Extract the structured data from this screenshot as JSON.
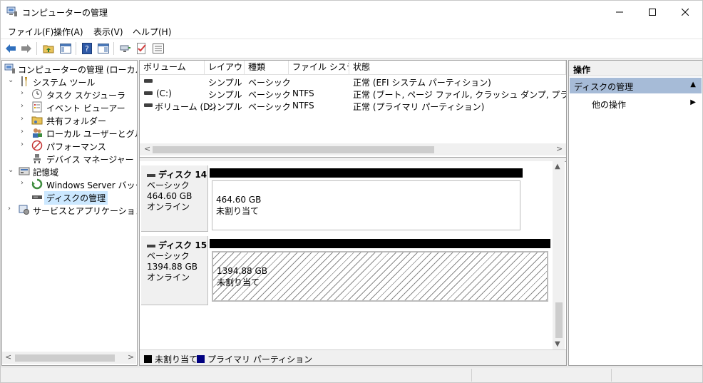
{
  "window": {
    "title": "コンピューターの管理",
    "minimize_glyph": "—",
    "maximize_glyph": "☐",
    "close_glyph": "✕"
  },
  "menu": [
    "ファイル(F)",
    "操作(A)",
    "表示(V)",
    "ヘルプ(H)"
  ],
  "toolbar": [
    "back-icon",
    "forward-icon",
    "up-folder-icon",
    "show-hide-tree-icon",
    "help-icon",
    "properties-icon",
    "connect-icon",
    "check-icon",
    "list-icon"
  ],
  "tree": {
    "items": [
      {
        "label": "コンピューターの管理 (ローカル)",
        "icon": "computer-management-icon",
        "expander": ""
      },
      {
        "label": "システム ツール",
        "icon": "system-tools-icon",
        "expander": "⌄"
      },
      {
        "label": "タスク スケジューラ",
        "icon": "task-scheduler-icon",
        "expander": "›"
      },
      {
        "label": "イベント ビューアー",
        "icon": "event-viewer-icon",
        "expander": "›"
      },
      {
        "label": "共有フォルダー",
        "icon": "shared-folders-icon",
        "expander": "›"
      },
      {
        "label": "ローカル ユーザーとグループ",
        "icon": "users-groups-icon",
        "expander": "›"
      },
      {
        "label": "パフォーマンス",
        "icon": "performance-icon",
        "expander": "›"
      },
      {
        "label": "デバイス マネージャー",
        "icon": "device-manager-icon",
        "expander": ""
      },
      {
        "label": "記憶域",
        "icon": "storage-icon",
        "expander": "⌄"
      },
      {
        "label": "Windows Server バックア",
        "icon": "backup-icon",
        "expander": "›"
      },
      {
        "label": "ディスクの管理",
        "icon": "disk-management-icon",
        "expander": ""
      },
      {
        "label": "サービスとアプリケーション",
        "icon": "services-icon",
        "expander": "›"
      }
    ]
  },
  "volumes": {
    "columns": [
      "ボリューム",
      "レイアウト",
      "種類",
      "ファイル システム",
      "状態"
    ],
    "rows": [
      {
        "volume": "",
        "layout": "シンプル",
        "type": "ベーシック",
        "fs": "",
        "status": "正常 (EFI システム パーティション)"
      },
      {
        "volume": "(C:)",
        "layout": "シンプル",
        "type": "ベーシック",
        "fs": "NTFS",
        "status": "正常 (ブート, ページ ファイル, クラッシュ ダンプ, プライマリ パーティション)"
      },
      {
        "volume": "ボリューム (D:)",
        "layout": "シンプル",
        "type": "ベーシック",
        "fs": "NTFS",
        "status": "正常 (プライマリ パーティション)"
      }
    ]
  },
  "disks": [
    {
      "name": "ディスク 14",
      "kind": "ベーシック",
      "size": "464.60 GB",
      "state": "オンライン",
      "partition_size": "464.60 GB",
      "partition_status": "未割り当て"
    },
    {
      "name": "ディスク 15",
      "kind": "ベーシック",
      "size": "1394.88 GB",
      "state": "オンライン",
      "partition_size": "1394.88 GB",
      "partition_status": "未割り当て"
    }
  ],
  "legend": [
    {
      "label": "未割り当て",
      "color": "#000000"
    },
    {
      "label": "プライマリ パーティション",
      "color": "#000080"
    }
  ],
  "actions": {
    "title": "操作",
    "section": "ディスクの管理",
    "item": "他の操作"
  },
  "colors": {
    "section_bg": "#a6bbd7",
    "selection_bg": "#cce8ff"
  }
}
